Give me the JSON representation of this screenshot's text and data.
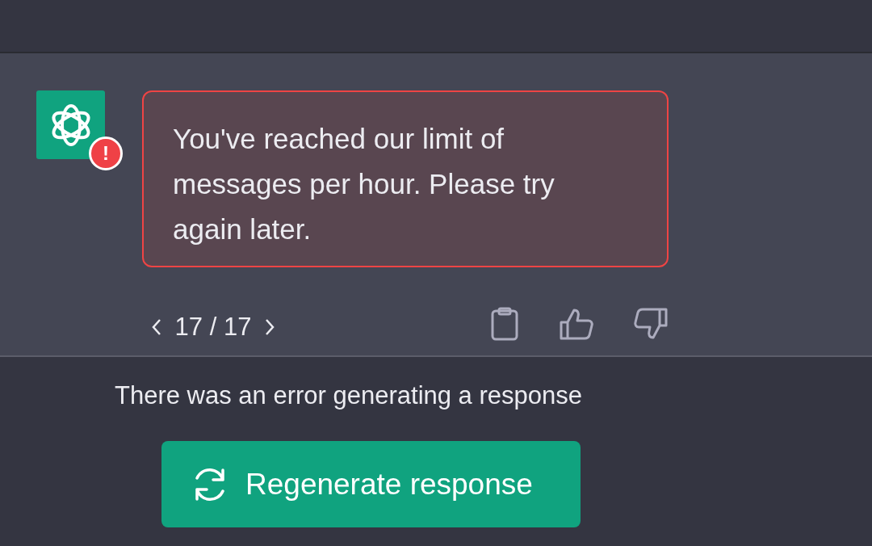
{
  "message": {
    "avatar_badge": "!",
    "text": "You've reached our limit of messages per hour. Please try again later.",
    "error": true
  },
  "pager": {
    "text": "17 / 17"
  },
  "error_notice": "There was an error generating a response",
  "regenerate_button": {
    "label": "Regenerate response"
  }
}
